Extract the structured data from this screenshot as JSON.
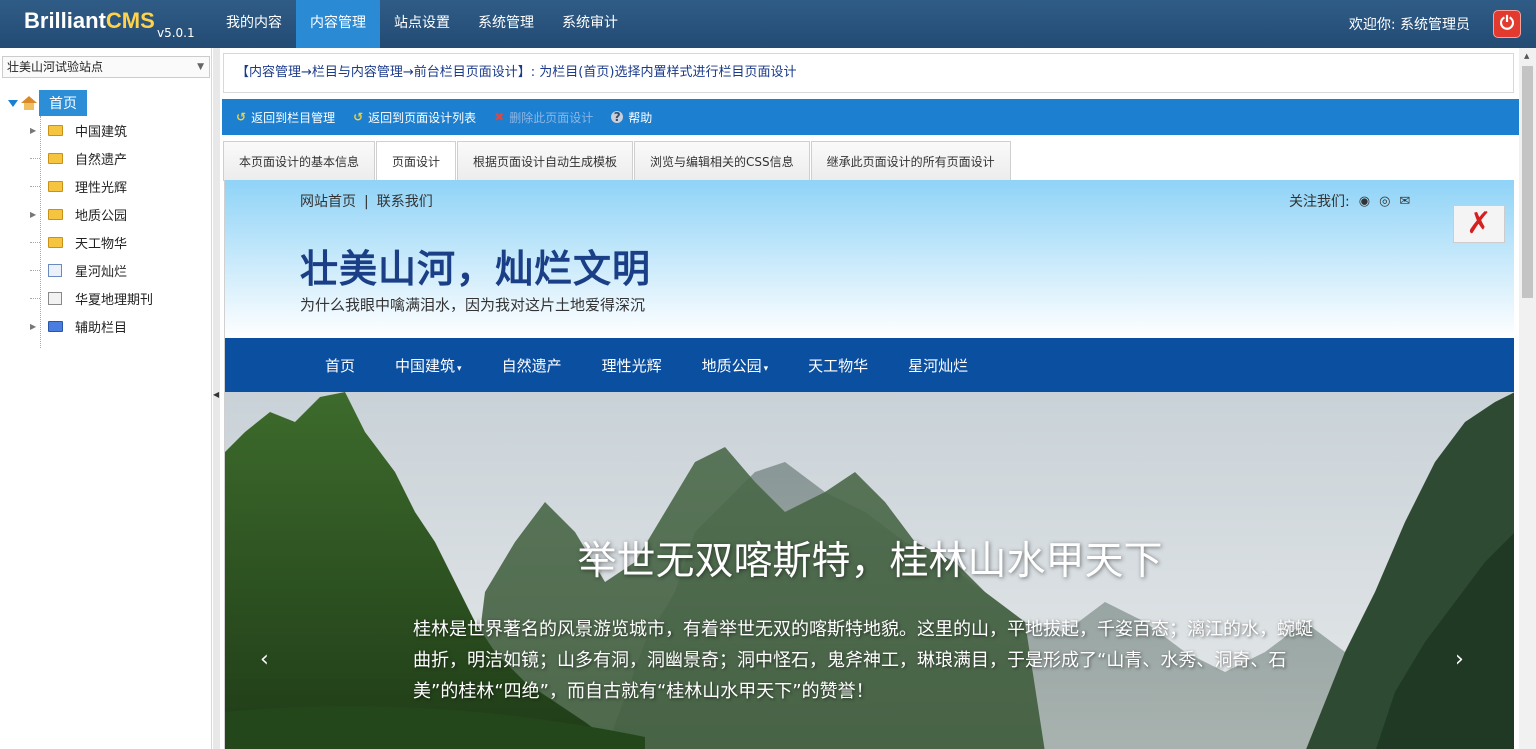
{
  "app": {
    "logo_main": "Brilliant",
    "logo_cms": "CMS",
    "version": "v5.0.1",
    "welcome": "欢迎你:  系统管理员"
  },
  "topnav": [
    "我的内容",
    "内容管理",
    "站点设置",
    "系统管理",
    "系统审计"
  ],
  "sidebar": {
    "site_selected": "壮美山河试验站点",
    "root": "首页",
    "items": [
      {
        "label": "中国建筑",
        "icon": "folder-icon",
        "expandable": true
      },
      {
        "label": "自然遗产",
        "icon": "folder-icon",
        "expandable": false
      },
      {
        "label": "理性光辉",
        "icon": "folder-icon",
        "expandable": false
      },
      {
        "label": "地质公园",
        "icon": "folder-icon",
        "expandable": true
      },
      {
        "label": "天工物华",
        "icon": "folder-icon",
        "expandable": false
      },
      {
        "label": "星河灿烂",
        "icon": "page-icon",
        "expandable": false
      },
      {
        "label": "华夏地理期刊",
        "icon": "page-gray-icon",
        "expandable": false
      },
      {
        "label": "辅助栏目",
        "icon": "folder-blue-icon",
        "expandable": true
      }
    ]
  },
  "breadcrumb": "【内容管理→栏目与内容管理→前台栏目页面设计】:  为栏目(首页)选择内置样式进行栏目页面设计",
  "toolbar": {
    "back_column": "返回到栏目管理",
    "back_list": "返回到页面设计列表",
    "delete": "删除此页面设计",
    "help": "帮助"
  },
  "tabs": [
    "本页面设计的基本信息",
    "页面设计",
    "根据页面设计自动生成模板",
    "浏览与编辑相关的CSS信息",
    "继承此页面设计的所有页面设计"
  ],
  "preview": {
    "link_home": "网站首页",
    "link_sep": "|",
    "link_contact": "联系我们",
    "follow": "关注我们:",
    "site_title": "壮美山河，灿烂文明",
    "site_subtitle": "为什么我眼中噙满泪水，因为我对这片土地爱得深沉",
    "nav": [
      {
        "label": "首页",
        "caret": ""
      },
      {
        "label": "中国建筑",
        "caret": "▾"
      },
      {
        "label": "自然遗产",
        "caret": ""
      },
      {
        "label": "理性光辉",
        "caret": ""
      },
      {
        "label": "地质公园",
        "caret": "▾"
      },
      {
        "label": "天工物华",
        "caret": ""
      },
      {
        "label": "星河灿烂",
        "caret": ""
      }
    ],
    "hero_title": "举世无双喀斯特，桂林山水甲天下",
    "hero_text": "桂林是世界著名的风景游览城市，有着举世无双的喀斯特地貌。这里的山，平地拔起，千姿百态；漓江的水，蜿蜒曲折，明洁如镜；山多有洞，洞幽景奇；洞中怪石，鬼斧神工，琳琅满目，于是形成了“山青、水秀、洞奇、石美”的桂林“四绝”，而自古就有“桂林山水甲天下”的赞誉！",
    "prev": "‹",
    "next": "›"
  },
  "colors": {
    "header_bg": "#234b74",
    "accent": "#1c7fd0",
    "site_nav": "#0b4fa1",
    "title": "#1b3f86"
  }
}
